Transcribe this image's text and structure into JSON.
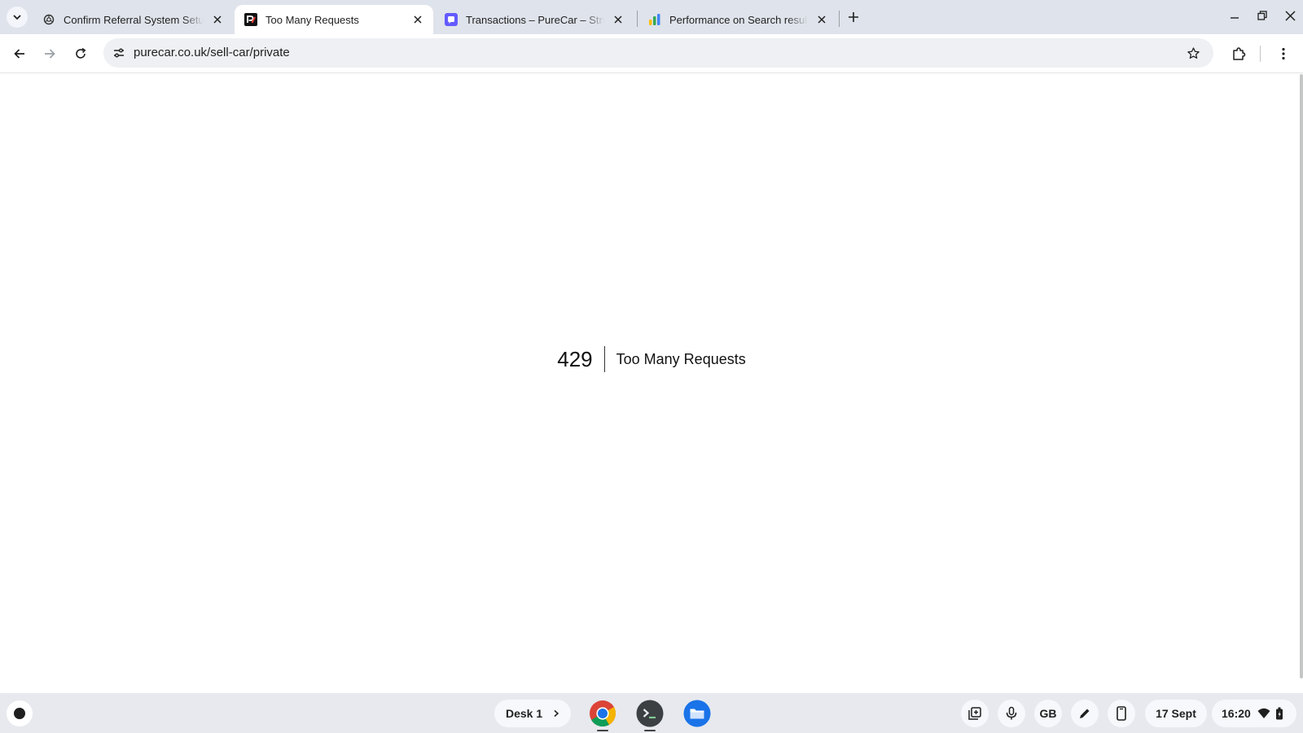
{
  "tabs": [
    {
      "title": "Confirm Referral System Setup",
      "icon": "openai-icon",
      "active": false
    },
    {
      "title": "Too Many Requests",
      "icon": "purecar-icon",
      "active": true
    },
    {
      "title": "Transactions – PureCar – Stripe",
      "icon": "stripe-icon",
      "active": false
    },
    {
      "title": "Performance on Search results",
      "icon": "google-ads-icon",
      "active": false
    }
  ],
  "address_bar": {
    "url": "purecar.co.uk/sell-car/private"
  },
  "page": {
    "error_code": "429",
    "error_message": "Too Many Requests"
  },
  "shelf": {
    "desk_label": "Desk 1",
    "keyboard_layout": "GB",
    "date": "17 Sept",
    "time": "16:20"
  },
  "colors": {
    "tabstrip": "#dfe3eb",
    "stripe_purple": "#635bff",
    "chrome_blue": "#1a73e8",
    "files_blue": "#1a73e8"
  }
}
